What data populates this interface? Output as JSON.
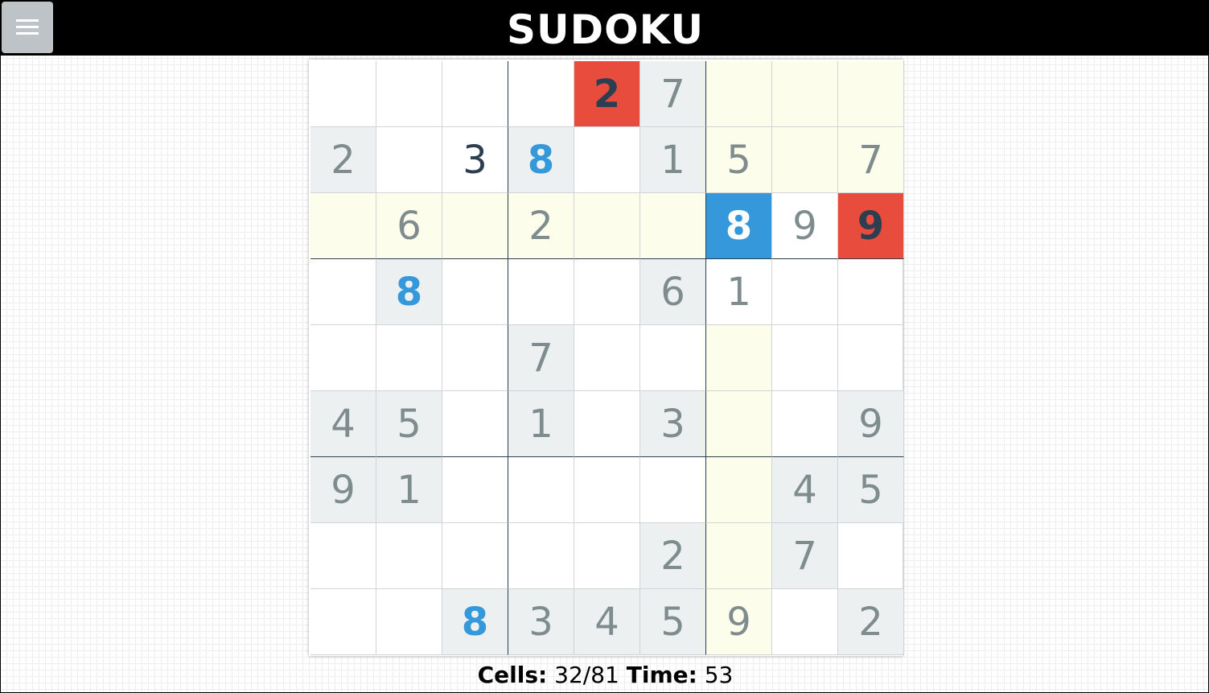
{
  "header": {
    "title": "SUDOKU",
    "menu_icon": "hamburger-menu-icon"
  },
  "board": {
    "rows": [
      [
        "",
        "",
        "",
        "",
        "2",
        "7",
        "",
        "",
        ""
      ],
      [
        "2",
        "",
        "3",
        "8",
        "",
        "1",
        "5",
        "",
        "7"
      ],
      [
        "",
        "6",
        "",
        "2",
        "",
        "",
        "8",
        "9",
        "9"
      ],
      [
        "",
        "8",
        "",
        "",
        "",
        "6",
        "1",
        "",
        ""
      ],
      [
        "",
        "",
        "",
        "7",
        "",
        "",
        "",
        "",
        ""
      ],
      [
        "4",
        "5",
        "",
        "1",
        "",
        "3",
        "",
        "",
        "9"
      ],
      [
        "9",
        "1",
        "",
        "",
        "",
        "",
        "",
        "4",
        "5"
      ],
      [
        "",
        "",
        "",
        "",
        "",
        "2",
        "",
        "7",
        ""
      ],
      [
        "",
        "",
        "8",
        "3",
        "4",
        "5",
        "9",
        "",
        "2"
      ]
    ],
    "given": [
      [
        0,
        5
      ],
      [
        1,
        0
      ],
      [
        1,
        3
      ],
      [
        1,
        5
      ],
      [
        3,
        1
      ],
      [
        3,
        5
      ],
      [
        4,
        3
      ],
      [
        5,
        0
      ],
      [
        5,
        1
      ],
      [
        5,
        3
      ],
      [
        5,
        5
      ],
      [
        5,
        8
      ],
      [
        6,
        0
      ],
      [
        6,
        1
      ],
      [
        6,
        7
      ],
      [
        6,
        8
      ],
      [
        7,
        5
      ],
      [
        7,
        7
      ],
      [
        8,
        2
      ],
      [
        8,
        3
      ],
      [
        8,
        4
      ],
      [
        8,
        5
      ],
      [
        8,
        8
      ]
    ],
    "highlighted": [
      [
        0,
        6
      ],
      [
        0,
        7
      ],
      [
        0,
        8
      ],
      [
        1,
        6
      ],
      [
        1,
        7
      ],
      [
        1,
        8
      ],
      [
        2,
        0
      ],
      [
        2,
        1
      ],
      [
        2,
        2
      ],
      [
        2,
        3
      ],
      [
        2,
        4
      ],
      [
        2,
        5
      ],
      [
        4,
        6
      ],
      [
        5,
        6
      ],
      [
        6,
        6
      ],
      [
        7,
        6
      ],
      [
        8,
        6
      ]
    ],
    "user_entries": [
      [
        1,
        2
      ]
    ],
    "same_number": [
      [
        1,
        3
      ],
      [
        3,
        1
      ],
      [
        8,
        2
      ]
    ],
    "errors": [
      [
        0,
        4
      ],
      [
        2,
        8
      ]
    ],
    "selected": [
      2,
      6
    ],
    "colors": {
      "given_bg": "#ecf0f1",
      "highlight_bg": "#fdfdeb",
      "error_bg": "#e74c3c",
      "selected_bg": "#3498db",
      "same_number_text": "#3498db",
      "given_text": "#7f8c8d",
      "user_text": "#2c3e50"
    }
  },
  "status": {
    "cells_label": "Cells:",
    "cells_value": "32/81",
    "time_label": "Time:",
    "time_value": "53"
  }
}
